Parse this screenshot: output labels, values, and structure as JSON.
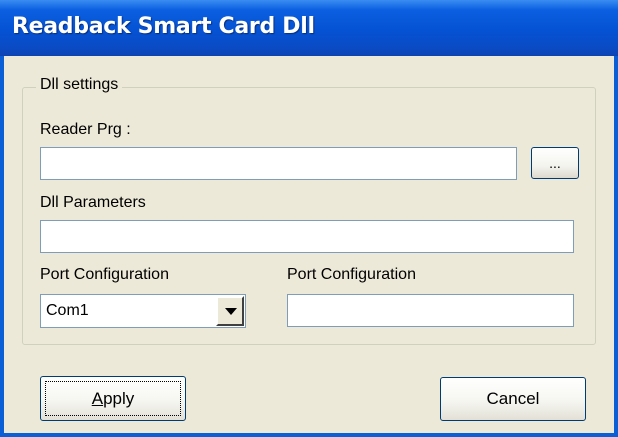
{
  "window": {
    "title": "Readback Smart Card Dll"
  },
  "group": {
    "label": "Dll settings"
  },
  "reader_prg": {
    "label": "Reader Prg :",
    "value": "",
    "browse_label": "..."
  },
  "dll_parameters": {
    "label": "Dll Parameters",
    "value": ""
  },
  "port_config_left": {
    "label": "Port Configuration",
    "selected": "Com1"
  },
  "port_config_right": {
    "label": "Port Configuration",
    "value": ""
  },
  "buttons": {
    "apply": "Apply",
    "cancel": "Cancel"
  },
  "icons": {
    "dropdown": "chevron-down-icon"
  },
  "colors": {
    "title_bar": "#0552d4",
    "window_border": "#0a5fd6",
    "dialog_background": "#ece9d8",
    "input_border": "#7f9db9",
    "button_border": "#003c74"
  }
}
